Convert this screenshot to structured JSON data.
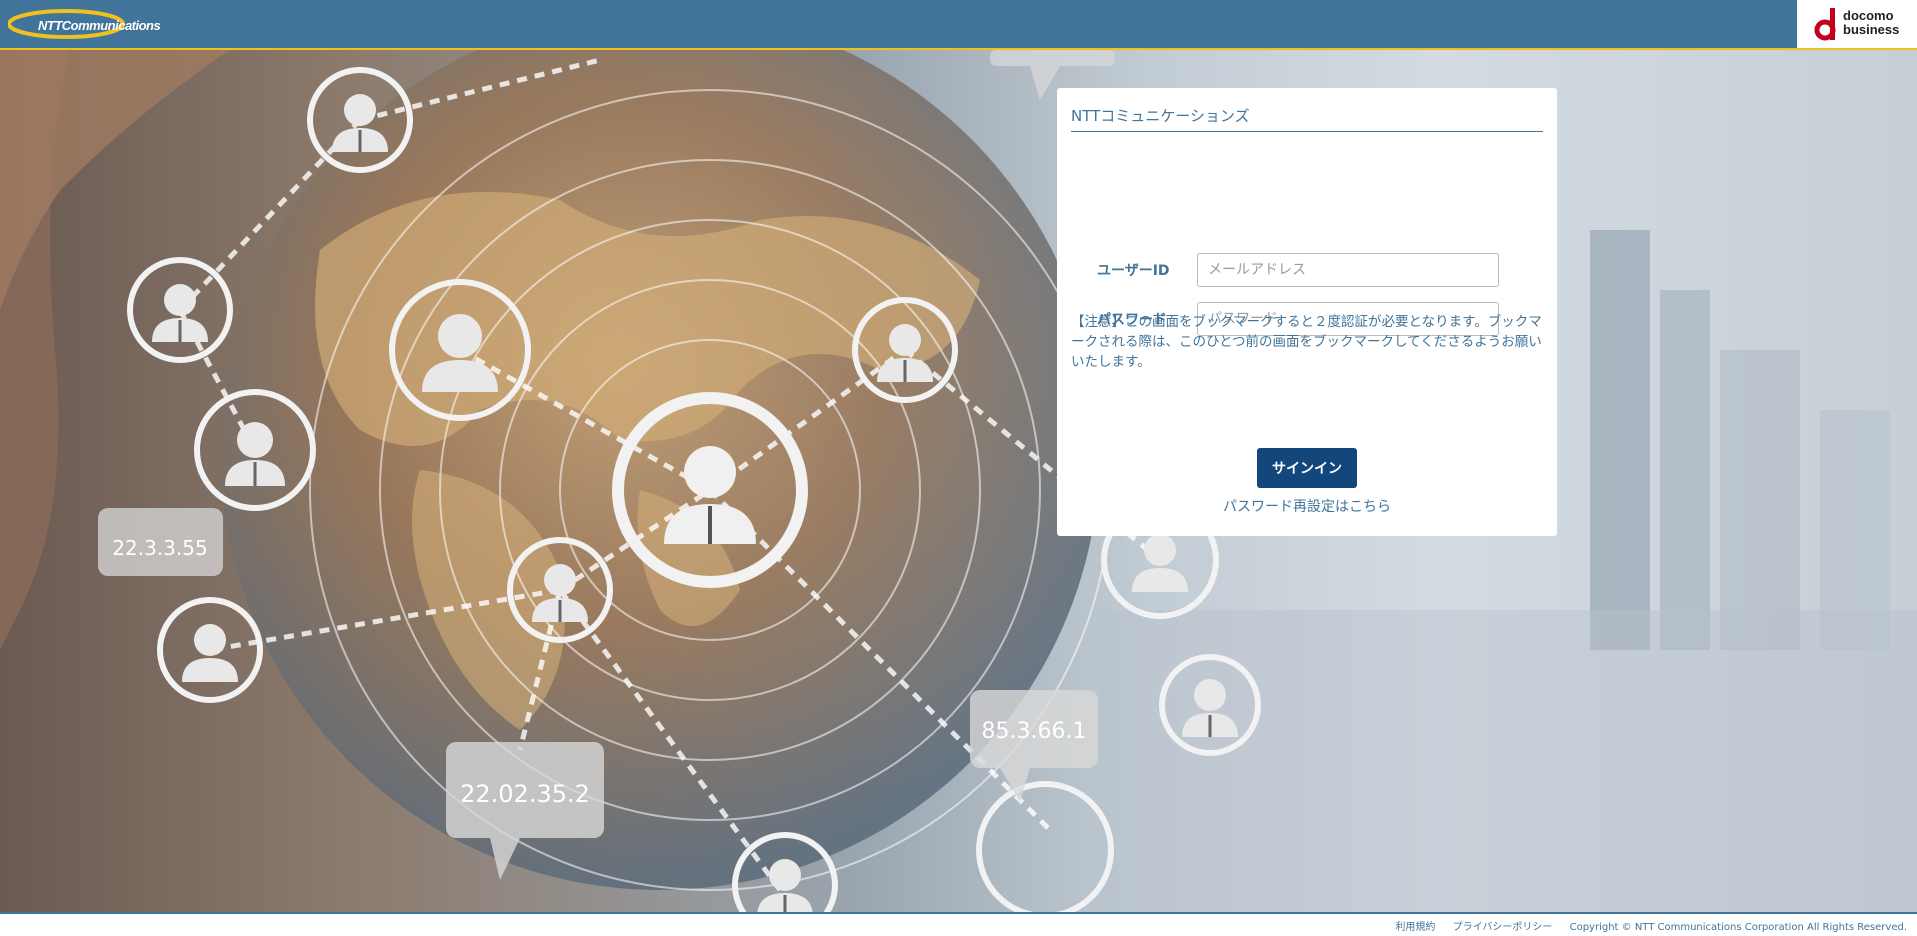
{
  "header": {
    "brand_logo": "NTTCommunications",
    "partner_logo_line1": "docomo",
    "partner_logo_line2": "business"
  },
  "background": {
    "bubbles": [
      "22.3.3.55",
      "22.02.35.2",
      "85.3.66.1"
    ]
  },
  "login": {
    "title": "NTTコミュニケーションズ",
    "user_id_label": "ユーザーID",
    "user_id_placeholder": "メールアドレス",
    "password_label": "パスワード",
    "password_placeholder": "パスワード",
    "notice": "【注意】この画面をブックマークすると２度認証が必要となります。ブックマークされる際は、このひとつ前の画面をブックマークしてくださるようお願いいたします。",
    "signin_button": "サインイン",
    "reset_link": "パスワード再設定はこちら"
  },
  "footer": {
    "terms_link": "利用規約",
    "privacy_link": "プライバシーポリシー",
    "copyright": "Copyright © NTT Communications Corporation All Rights Reserved."
  },
  "colors": {
    "header_bg": "#41749a",
    "header_accent": "#f0c020",
    "button_bg": "#13467a",
    "text_accent": "#41749a"
  }
}
